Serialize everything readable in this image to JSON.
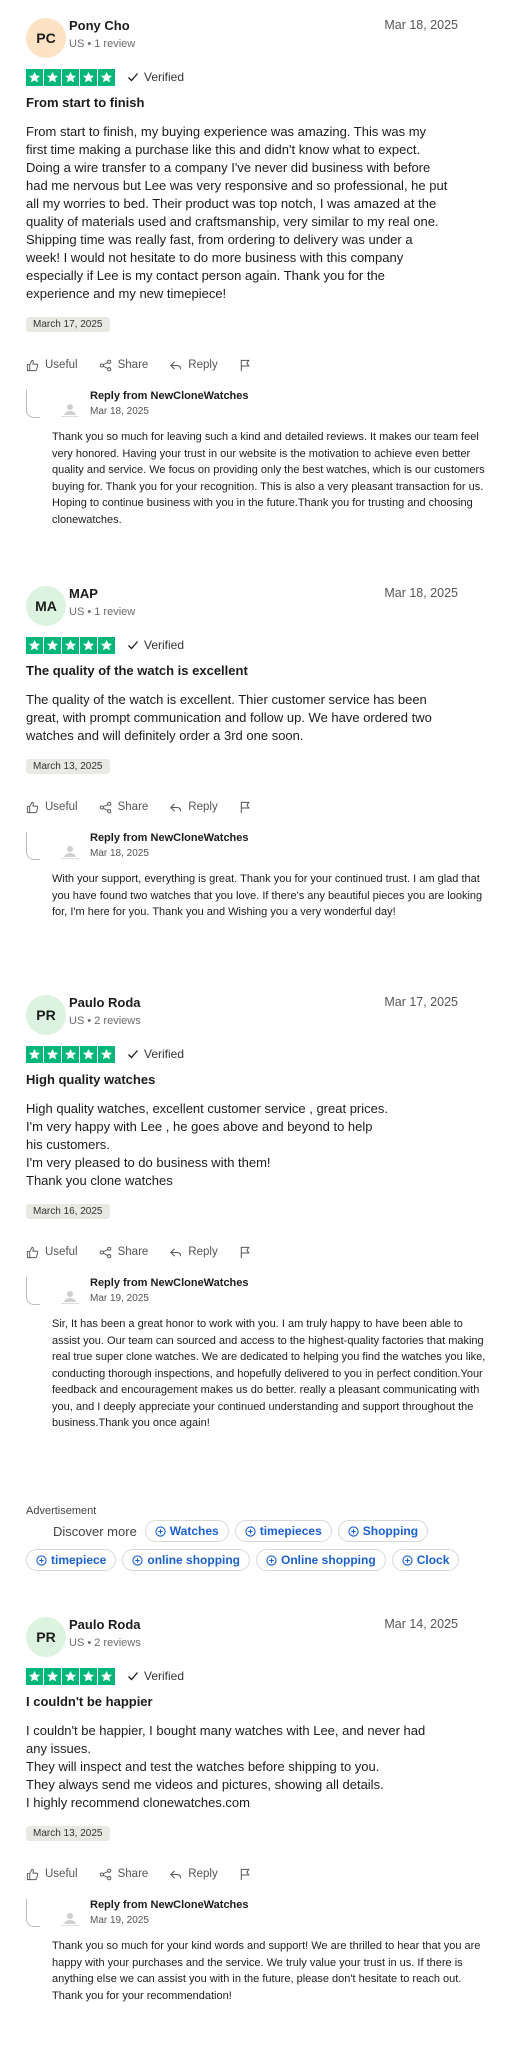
{
  "ad": {
    "label": "Advertisement",
    "discover": "Discover more",
    "row1": [
      "Watches",
      "timepieces",
      "Shopping"
    ],
    "row2": [
      "timepiece",
      "online shopping",
      "Online shopping",
      "Clock"
    ]
  },
  "actions": {
    "useful": "Useful",
    "share": "Share",
    "reply": "Reply"
  },
  "colors": {
    "star_green": "#00b67a",
    "chip_blue": "#1a5fd0"
  },
  "reviews": [
    {
      "initials": "PC",
      "avatar_color": "#fde3c4",
      "name": "Pony Cho",
      "meta": "US • 1 review",
      "date": "Mar 18, 2025",
      "stars": 5,
      "verified": "Verified",
      "title": "From start to finish",
      "body": "From start to finish, my buying experience was amazing. This was my\nfirst time making a purchase like this and didn't know what to expect.\nDoing a wire transfer to a company I've never did business with before\nhad me nervous but Lee was very responsive and so professional, he put\nall my worries to bed. Their product was top notch, I was amazed at the\nquality of materials used and craftsmanship, very similar to my real one.\nShipping time was really fast, from ordering to delivery was under a\nweek! I would not hesitate to do more business with this company\nespecially if Lee is my contact person again. Thank you for the\nexperience and my new timepiece!",
      "experience_date": "March 17, 2025",
      "reply": {
        "from": "Reply from NewCloneWatches",
        "date": "Mar 18, 2025",
        "text": "Thank you so much for leaving such a kind and detailed reviews. It makes our team feel very honored. Having your trust in our website is the motivation to achieve even better quality and service. We focus on providing only the best watches, which is our customers buying for. Thank you for your recognition. This is also a very pleasant transaction for us. Hoping to continue business with you in the future.Thank you for trusting and choosing clonewatches."
      }
    },
    {
      "initials": "MA",
      "avatar_color": "#dcf3e0",
      "name": "MAP",
      "meta": "US • 1 review",
      "date": "Mar 18, 2025",
      "stars": 5,
      "verified": "Verified",
      "title": "The quality of the watch is excellent",
      "body": "The quality of the watch is excellent. Thier customer service has been\ngreat, with prompt communication and follow up. We have ordered two\nwatches and will definitely order a 3rd one soon.",
      "experience_date": "March 13, 2025",
      "reply": {
        "from": "Reply from NewCloneWatches",
        "date": "Mar 18, 2025",
        "text": "With your support, everything is great. Thank you for your continued trust. I am glad that you have found two watches that you love. If there's any beautiful pieces you are looking for, I'm here for you. Thank you and Wishing you a very wonderful day!"
      }
    },
    {
      "initials": "PR",
      "avatar_color": "#dcf3e0",
      "name": "Paulo Roda",
      "meta": "US • 2 reviews",
      "date": "Mar 17, 2025",
      "stars": 5,
      "verified": "Verified",
      "title": "High quality watches",
      "body": "High quality watches, excellent customer service , great prices.\nI'm very happy with Lee , he goes above and beyond to help\nhis customers.\nI'm very pleased to do business with them!\nThank you clone watches",
      "experience_date": "March 16, 2025",
      "reply": {
        "from": "Reply from NewCloneWatches",
        "date": "Mar 19, 2025",
        "text": "Sir, It has been a great honor to work with you. I am truly happy to have been able to assist you. Our team can sourced and access to the highest-quality factories that making real true super clone watches. We are dedicated to helping you find the watches you like, conducting thorough inspections, and hopefully delivered to you in perfect condition.Your feedback and encouragement makes us do better. really a pleasant communicating with you, and I deeply appreciate your continued understanding and support throughout the business.Thank you once again!"
      }
    },
    {
      "initials": "PR",
      "avatar_color": "#dcf3e0",
      "name": "Paulo Roda",
      "meta": "US • 2 reviews",
      "date": "Mar 14, 2025",
      "stars": 5,
      "verified": "Verified",
      "title": "I couldn't be happier",
      "body": "I couldn't be happier, I bought many watches with Lee, and never had\nany issues.\nThey will inspect and test the watches before shipping to you.\nThey always send me videos and pictures, showing all details.\nI highly recommend clonewatches.com",
      "experience_date": "March 13, 2025",
      "reply": {
        "from": "Reply from NewCloneWatches",
        "date": "Mar 19, 2025",
        "text": "Thank you so much for your kind words and support! We are thrilled to hear that you are happy with your purchases and the service. We truly value your trust in us. If there is anything else we can assist you with in the future, please don't hesitate to reach out. Thank you for your recommendation!"
      }
    }
  ]
}
